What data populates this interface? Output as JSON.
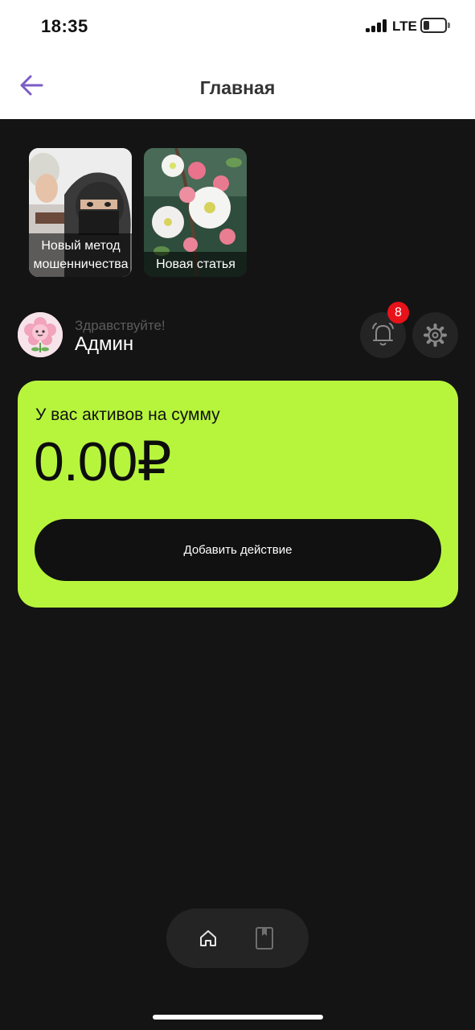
{
  "status_bar": {
    "time": "18:35",
    "network": "LTE"
  },
  "header": {
    "title": "Главная",
    "back_icon": "arrow-left-icon",
    "accent_color": "#7b5cc4"
  },
  "stories": [
    {
      "label": "Новый метод мошенничества"
    },
    {
      "label": "Новая статья"
    }
  ],
  "greeting": {
    "hello": "Здравствуйте!",
    "name": "Админ",
    "notifications_count": "8",
    "bell_icon": "bell-icon",
    "settings_icon": "gear-icon"
  },
  "balance_card": {
    "label": "У вас активов на сумму",
    "value": "0.00₽",
    "button_label": "Добавить действие",
    "color": "#b7f53c"
  },
  "tab_bar": {
    "items": [
      {
        "icon": "home-icon"
      },
      {
        "icon": "bookmark-icon"
      }
    ]
  }
}
